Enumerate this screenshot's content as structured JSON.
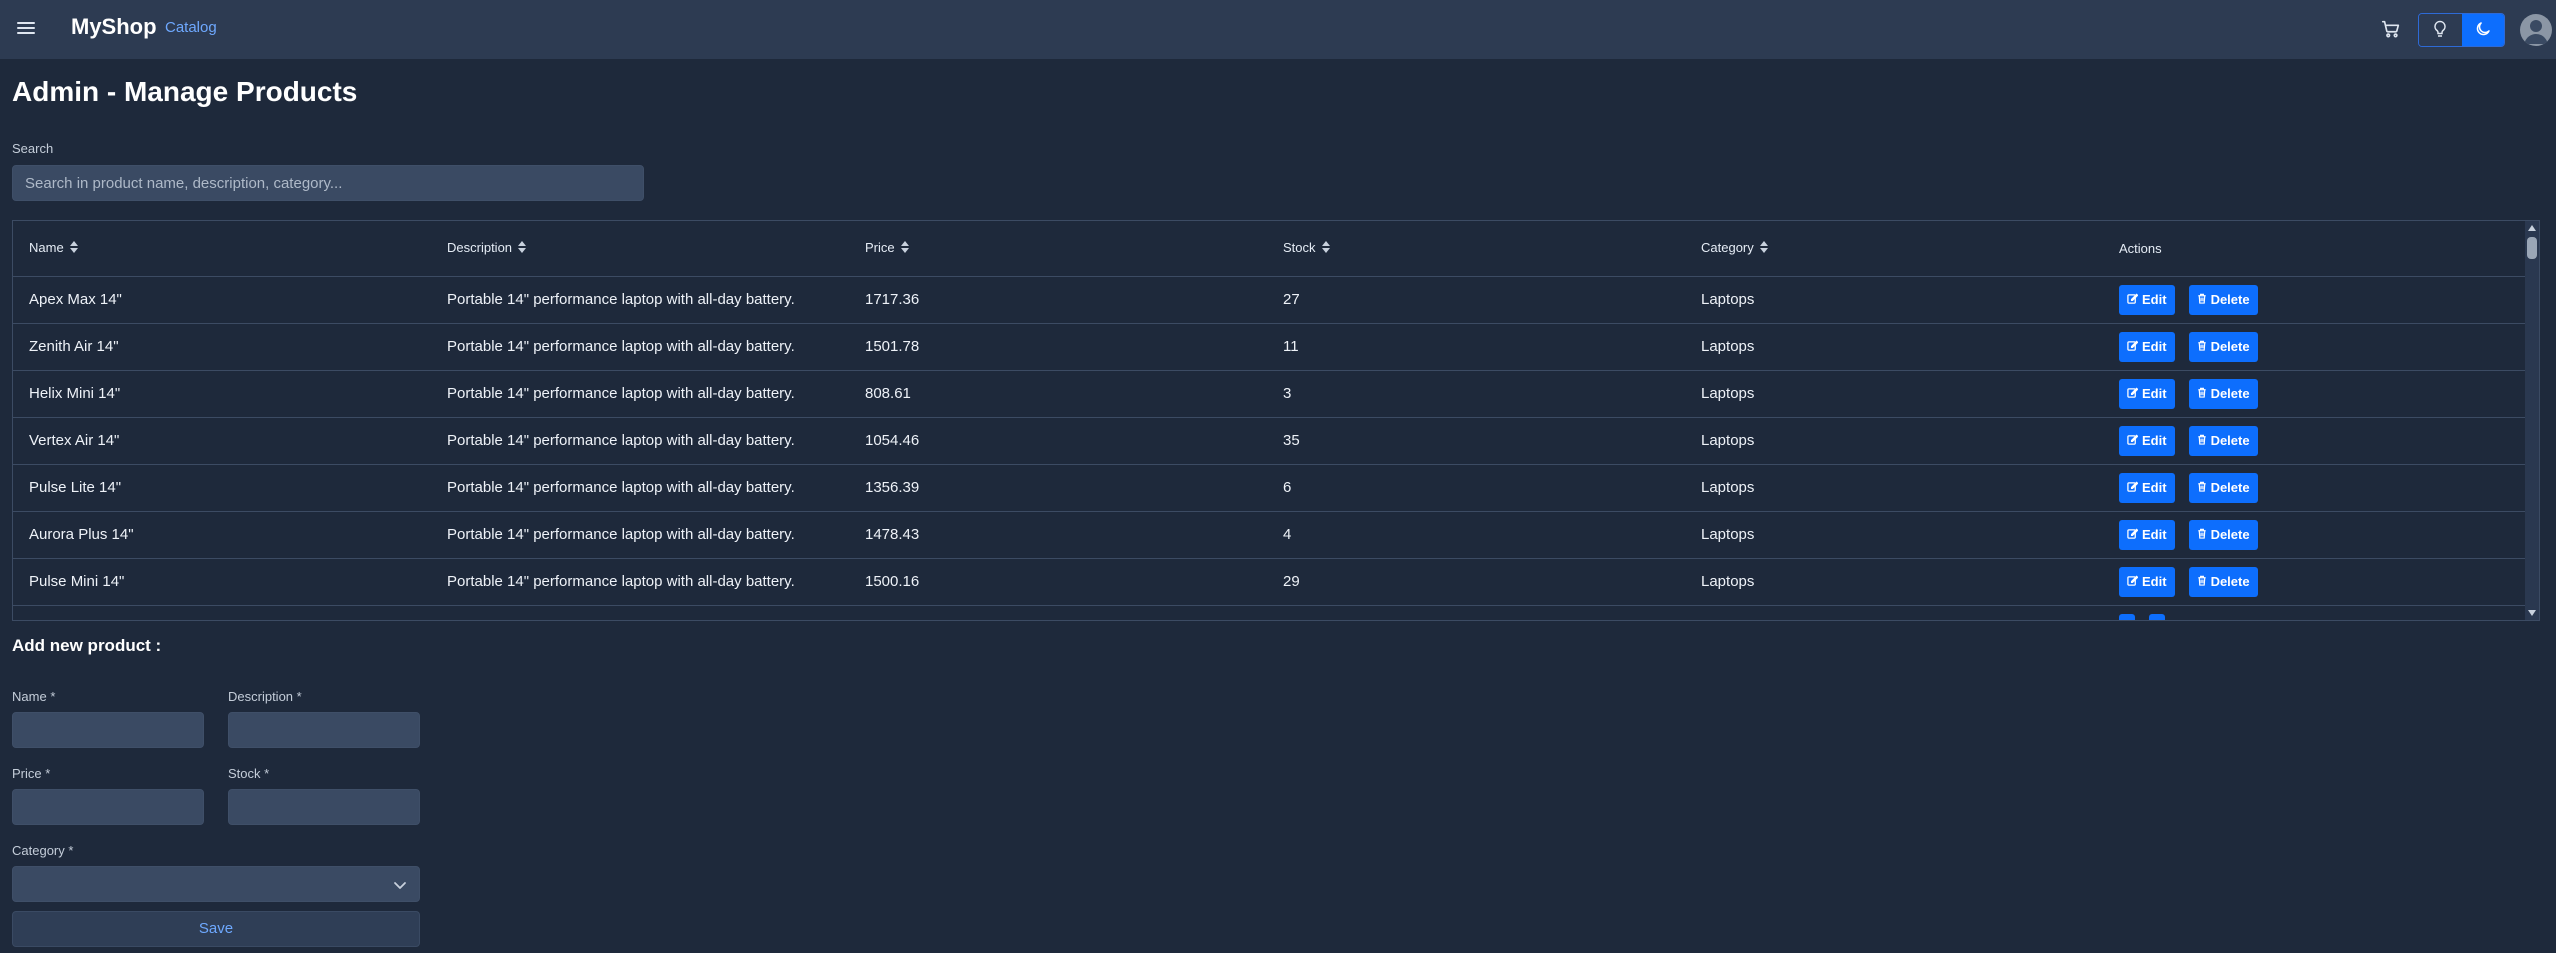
{
  "app": {
    "brand": "MyShop",
    "nav_catalog": "Catalog"
  },
  "page": {
    "title": "Admin - Manage Products"
  },
  "search": {
    "label": "Search",
    "placeholder": "Search in product name, description, category..."
  },
  "table": {
    "headers": {
      "name": "Name",
      "description": "Description",
      "price": "Price",
      "stock": "Stock",
      "category": "Category",
      "actions": "Actions"
    },
    "edit_label": "Edit",
    "delete_label": "Delete",
    "rows": [
      {
        "name": "Apex Max 14\"",
        "description": "Portable 14\" performance laptop with all-day battery.",
        "price": "1717.36",
        "stock": "27",
        "category": "Laptops"
      },
      {
        "name": "Zenith Air 14\"",
        "description": "Portable 14\" performance laptop with all-day battery.",
        "price": "1501.78",
        "stock": "11",
        "category": "Laptops"
      },
      {
        "name": "Helix Mini 14\"",
        "description": "Portable 14\" performance laptop with all-day battery.",
        "price": "808.61",
        "stock": "3",
        "category": "Laptops"
      },
      {
        "name": "Vertex Air 14\"",
        "description": "Portable 14\" performance laptop with all-day battery.",
        "price": "1054.46",
        "stock": "35",
        "category": "Laptops"
      },
      {
        "name": "Pulse Lite 14\"",
        "description": "Portable 14\" performance laptop with all-day battery.",
        "price": "1356.39",
        "stock": "6",
        "category": "Laptops"
      },
      {
        "name": "Aurora Plus 14\"",
        "description": "Portable 14\" performance laptop with all-day battery.",
        "price": "1478.43",
        "stock": "4",
        "category": "Laptops"
      },
      {
        "name": "Pulse Mini 14\"",
        "description": "Portable 14\" performance laptop with all-day battery.",
        "price": "1500.16",
        "stock": "29",
        "category": "Laptops"
      }
    ]
  },
  "form": {
    "title": "Add new product :",
    "name_label": "Name",
    "description_label": "Description",
    "price_label": "Price",
    "stock_label": "Stock",
    "category_label": "Category",
    "required_mark": "*",
    "category_value": "",
    "save_label": "Save"
  },
  "colors": {
    "accent": "#0d6efd",
    "background": "#1e293b",
    "topbar": "#2d3b52",
    "link": "#6ea8fe"
  },
  "icons": [
    "menu-icon",
    "cart-icon",
    "lightbulb-icon",
    "moon-icon",
    "user-avatar-icon",
    "sort-icon",
    "edit-icon",
    "trash-icon",
    "chevron-down-icon"
  ]
}
